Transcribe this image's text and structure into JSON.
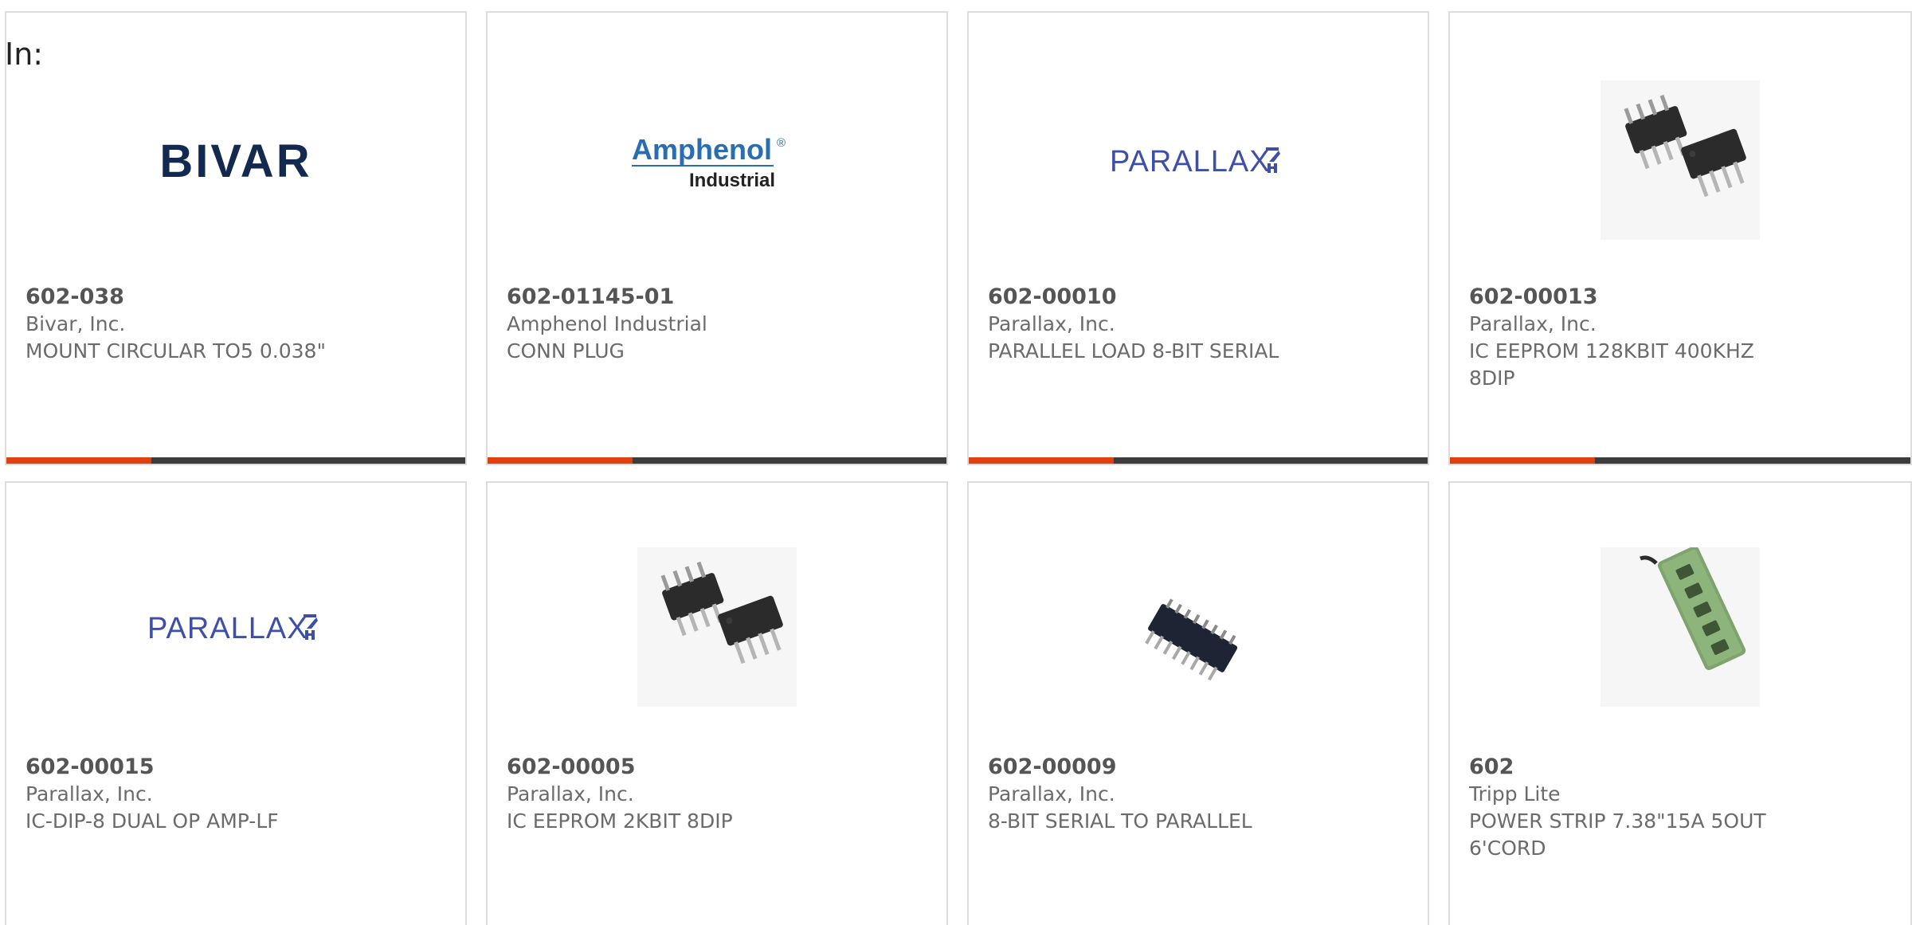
{
  "filter": {
    "label": "In:"
  },
  "colors": {
    "accent": "#e0400e",
    "bar_dark": "#3c3c3c",
    "bivar_navy": "#14294f",
    "amphenol_blue": "#2a6db3",
    "parallax_blue": "#3d4fa6"
  },
  "products": [
    {
      "part_number": "602-038",
      "manufacturer": "Bivar, Inc.",
      "description": "MOUNT CIRCULAR TO5 0.038\"",
      "image": "bivar-logo"
    },
    {
      "part_number": "602-01145-01",
      "manufacturer": "Amphenol Industrial",
      "description": "CONN PLUG",
      "image": "amphenol-logo"
    },
    {
      "part_number": "602-00010",
      "manufacturer": "Parallax, Inc.",
      "description": "PARALLEL LOAD 8-BIT SERIAL",
      "image": "parallax-logo"
    },
    {
      "part_number": "602-00013",
      "manufacturer": "Parallax, Inc.",
      "description": "IC EEPROM 128KBIT 400KHZ 8DIP",
      "image": "dip8-chips-photo"
    },
    {
      "part_number": "602-00015",
      "manufacturer": "Parallax, Inc.",
      "description": "IC-DIP-8 DUAL OP AMP-LF",
      "image": "parallax-logo"
    },
    {
      "part_number": "602-00005",
      "manufacturer": "Parallax, Inc.",
      "description": "IC EEPROM 2KBIT 8DIP",
      "image": "dip8-chips-photo"
    },
    {
      "part_number": "602-00009",
      "manufacturer": "Parallax, Inc.",
      "description": "8-BIT SERIAL TO PARALLEL",
      "image": "dip16-chip-photo"
    },
    {
      "part_number": "602",
      "manufacturer": "Tripp Lite",
      "description": "POWER STRIP 7.38\"15A 5OUT 6'CORD",
      "image": "power-strip-photo"
    }
  ],
  "logos": {
    "bivar": "BIVAR",
    "amphenol_main": "Amphenol",
    "amphenol_reg": "®",
    "amphenol_sub": "Industrial",
    "parallax": "PARALLAX"
  }
}
